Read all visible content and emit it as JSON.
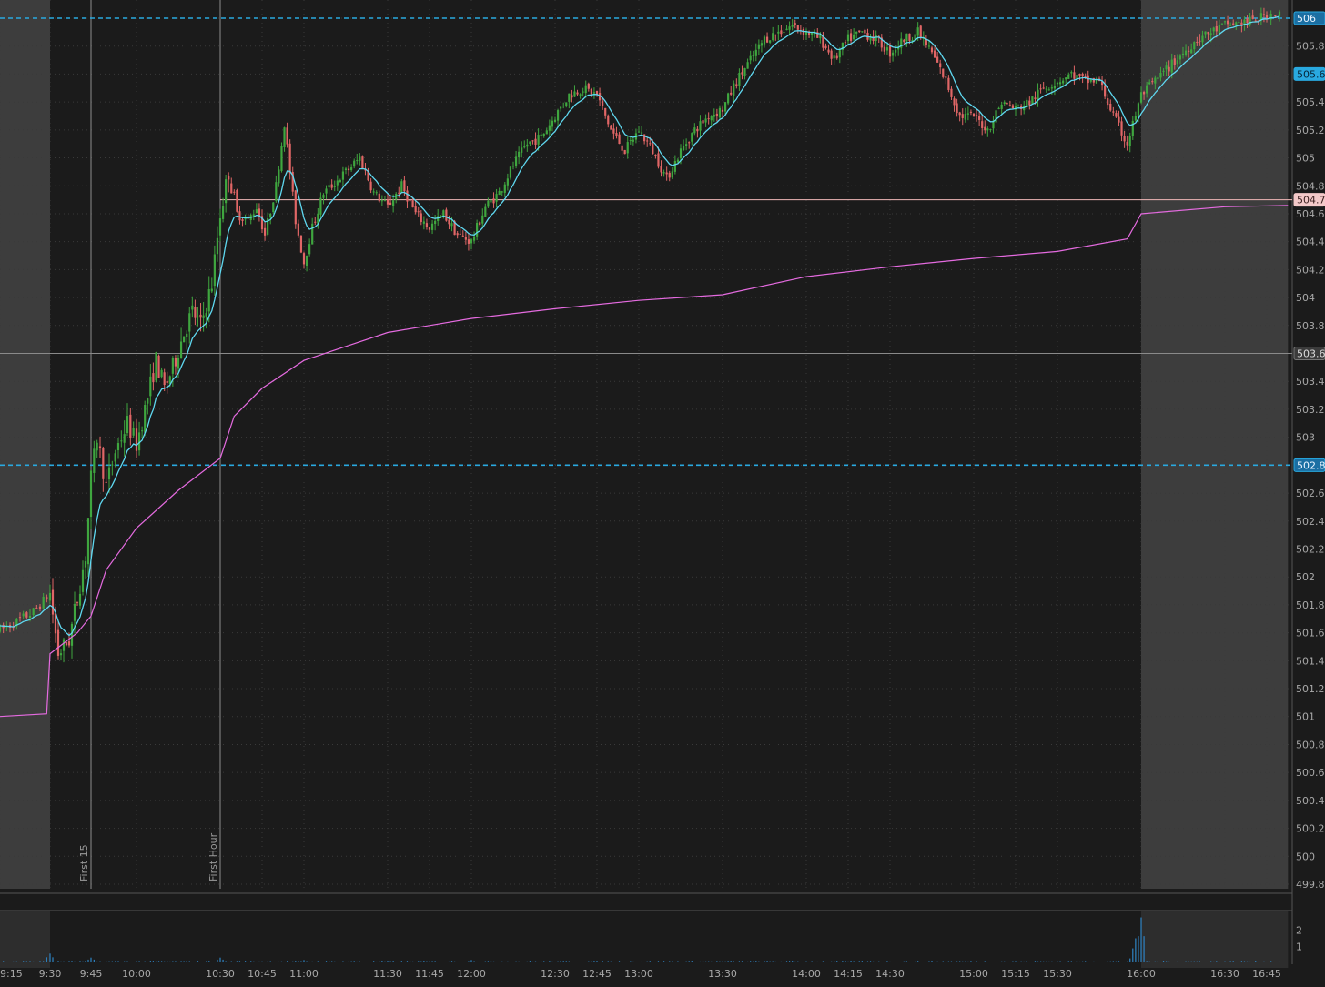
{
  "colors": {
    "background": "#1b1b1b",
    "extended_hours_shade": "#3d3d3d",
    "grid": "#3a3a3a",
    "up_candle": "#3fa63f",
    "down_candle": "#e06666",
    "ema_line": "#5fd8f0",
    "vwap_line": "#e56be0",
    "level_line": "#29a9e0",
    "reference_line": "#f0b8b8",
    "axis_text": "#a9a9a9",
    "volume": "#2f84c4"
  },
  "chart_data": {
    "type": "candlestick",
    "symbol_timeframe": "1-minute intraday",
    "ylim": [
      499.8,
      506.1
    ],
    "yticks": [
      "506",
      "505.8",
      "505.6",
      "505.4",
      "505.2",
      "505",
      "504.8",
      "504.6",
      "504.4",
      "504.2",
      "504",
      "503.8",
      "503.6",
      "503.4",
      "503.2",
      "503",
      "502.8",
      "502.6",
      "502.4",
      "502.2",
      "502",
      "501.8",
      "501.6",
      "501.4",
      "501.2",
      "501",
      "500.8",
      "500.6",
      "500.4",
      "500.2",
      "500",
      "499.8"
    ],
    "xticks": [
      "9:15",
      "9:30",
      "9:45",
      "10:00",
      "10:30",
      "10:45",
      "11:00",
      "11:30",
      "11:45",
      "12:00",
      "12:30",
      "12:45",
      "13:00",
      "13:30",
      "14:00",
      "14:15",
      "14:30",
      "15:00",
      "15:15",
      "15:30",
      "16:00",
      "16:30",
      "16:45"
    ],
    "extended_hours": [
      [
        "9:15",
        "9:30"
      ],
      [
        "16:00",
        "16:50"
      ]
    ],
    "vertical_markers": [
      {
        "time": "9:45",
        "label": "First 15"
      },
      {
        "time": "10:30",
        "label": "First Hour"
      }
    ],
    "price_levels": [
      {
        "value": 506.0,
        "label": "506",
        "style": "dashed",
        "color": "#29a9e0"
      },
      {
        "value": 502.8,
        "label": "502.8",
        "style": "dashed",
        "color": "#29a9e0"
      },
      {
        "value": 504.7,
        "label": "504.7",
        "style": "solid",
        "color": "#f0b8b8",
        "from": "10:30"
      },
      {
        "value": 503.6,
        "label": "503.6",
        "style": "crosshair",
        "color": "#8a8a8a"
      }
    ],
    "last_price_label": {
      "value": 505.6,
      "label": "505.6"
    },
    "price_path": [
      [
        "9:15",
        501.62
      ],
      [
        "9:20",
        501.68
      ],
      [
        "9:25",
        501.75
      ],
      [
        "9:30",
        501.88
      ],
      [
        "9:33",
        501.45
      ],
      [
        "9:37",
        501.55
      ],
      [
        "9:40",
        501.85
      ],
      [
        "9:43",
        502.15
      ],
      [
        "9:45",
        502.7
      ],
      [
        "9:47",
        503.0
      ],
      [
        "9:50",
        502.65
      ],
      [
        "9:53",
        502.9
      ],
      [
        "9:57",
        503.1
      ],
      [
        "10:00",
        502.95
      ],
      [
        "10:03",
        503.2
      ],
      [
        "10:07",
        503.55
      ],
      [
        "10:10",
        503.35
      ],
      [
        "10:13",
        503.5
      ],
      [
        "10:17",
        503.75
      ],
      [
        "10:20",
        503.9
      ],
      [
        "10:23",
        503.8
      ],
      [
        "10:27",
        504.1
      ],
      [
        "10:30",
        504.6
      ],
      [
        "10:33",
        504.9
      ],
      [
        "10:36",
        504.6
      ],
      [
        "10:40",
        504.55
      ],
      [
        "10:43",
        504.65
      ],
      [
        "10:46",
        504.45
      ],
      [
        "10:50",
        504.8
      ],
      [
        "10:53",
        505.25
      ],
      [
        "10:57",
        504.55
      ],
      [
        "11:00",
        504.25
      ],
      [
        "11:03",
        504.5
      ],
      [
        "11:07",
        504.75
      ],
      [
        "11:10",
        504.8
      ],
      [
        "11:15",
        504.9
      ],
      [
        "11:20",
        505.0
      ],
      [
        "11:25",
        504.75
      ],
      [
        "11:30",
        504.65
      ],
      [
        "11:35",
        504.8
      ],
      [
        "11:40",
        504.6
      ],
      [
        "11:45",
        504.5
      ],
      [
        "11:50",
        504.6
      ],
      [
        "11:55",
        504.45
      ],
      [
        "12:00",
        504.4
      ],
      [
        "12:05",
        504.65
      ],
      [
        "12:10",
        504.75
      ],
      [
        "12:15",
        504.95
      ],
      [
        "12:20",
        505.1
      ],
      [
        "12:25",
        505.15
      ],
      [
        "12:30",
        505.3
      ],
      [
        "12:35",
        505.45
      ],
      [
        "12:40",
        505.5
      ],
      [
        "12:45",
        505.45
      ],
      [
        "12:50",
        505.2
      ],
      [
        "12:55",
        505.05
      ],
      [
        "13:00",
        505.2
      ],
      [
        "13:05",
        505.05
      ],
      [
        "13:10",
        504.85
      ],
      [
        "13:15",
        505.05
      ],
      [
        "13:20",
        505.2
      ],
      [
        "13:25",
        505.3
      ],
      [
        "13:30",
        505.35
      ],
      [
        "13:35",
        505.55
      ],
      [
        "13:40",
        505.7
      ],
      [
        "13:45",
        505.85
      ],
      [
        "13:50",
        505.9
      ],
      [
        "13:55",
        505.95
      ],
      [
        "14:00",
        505.9
      ],
      [
        "14:05",
        505.85
      ],
      [
        "14:10",
        505.7
      ],
      [
        "14:15",
        505.85
      ],
      [
        "14:20",
        505.9
      ],
      [
        "14:25",
        505.85
      ],
      [
        "14:30",
        505.75
      ],
      [
        "14:35",
        505.85
      ],
      [
        "14:40",
        505.9
      ],
      [
        "14:45",
        505.75
      ],
      [
        "14:50",
        505.55
      ],
      [
        "14:55",
        505.3
      ],
      [
        "15:00",
        505.3
      ],
      [
        "15:05",
        505.2
      ],
      [
        "15:10",
        505.4
      ],
      [
        "15:15",
        505.35
      ],
      [
        "15:20",
        505.4
      ],
      [
        "15:25",
        505.5
      ],
      [
        "15:30",
        505.55
      ],
      [
        "15:35",
        505.6
      ],
      [
        "15:40",
        505.55
      ],
      [
        "15:45",
        505.55
      ],
      [
        "15:50",
        505.3
      ],
      [
        "15:55",
        505.1
      ],
      [
        "16:00",
        505.45
      ],
      [
        "16:10",
        505.65
      ],
      [
        "16:20",
        505.85
      ],
      [
        "16:30",
        505.95
      ],
      [
        "16:40",
        505.98
      ],
      [
        "16:48",
        506.05
      ]
    ],
    "vwap_path": [
      [
        "9:15",
        501.0
      ],
      [
        "9:29",
        501.02
      ],
      [
        "9:30",
        501.45
      ],
      [
        "9:40",
        501.6
      ],
      [
        "9:45",
        501.72
      ],
      [
        "9:50",
        502.05
      ],
      [
        "10:00",
        502.35
      ],
      [
        "10:15",
        502.62
      ],
      [
        "10:30",
        502.85
      ],
      [
        "10:35",
        503.15
      ],
      [
        "10:45",
        503.35
      ],
      [
        "11:00",
        503.55
      ],
      [
        "11:15",
        503.65
      ],
      [
        "11:30",
        503.75
      ],
      [
        "11:45",
        503.8
      ],
      [
        "12:00",
        503.85
      ],
      [
        "12:30",
        503.92
      ],
      [
        "13:00",
        503.98
      ],
      [
        "13:30",
        504.02
      ],
      [
        "14:00",
        504.15
      ],
      [
        "14:30",
        504.22
      ],
      [
        "15:00",
        504.28
      ],
      [
        "15:30",
        504.33
      ],
      [
        "15:55",
        504.42
      ],
      [
        "16:00",
        504.6
      ],
      [
        "16:30",
        504.65
      ],
      [
        "16:50",
        504.66
      ]
    ],
    "volume_axis": [
      "2",
      "1"
    ],
    "volume_spikes": [
      [
        "9:30",
        0.55
      ],
      [
        "9:45",
        0.3
      ],
      [
        "10:30",
        0.3
      ],
      [
        "11:00",
        0.15
      ],
      [
        "12:00",
        0.15
      ],
      [
        "15:58",
        1.5
      ],
      [
        "16:00",
        2.8
      ]
    ]
  }
}
